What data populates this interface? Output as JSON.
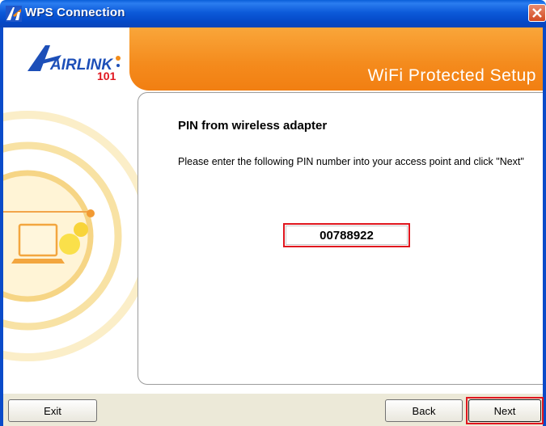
{
  "window": {
    "title": "WPS Connection"
  },
  "header": {
    "brand": "AIRLINK",
    "brand_number": "101",
    "banner_title": "WiFi Protected Setup"
  },
  "main": {
    "heading": "PIN from wireless adapter",
    "instructions": "Please enter the following PIN number into your access point and click \"Next\"",
    "pin": "00788922"
  },
  "buttons": {
    "exit": "Exit",
    "back": "Back",
    "next": "Next"
  },
  "colors": {
    "titlebar": "#0a5fd8",
    "orange": "#f48a1c",
    "highlight": "#e0161e",
    "button_bar": "#ece9d8"
  }
}
